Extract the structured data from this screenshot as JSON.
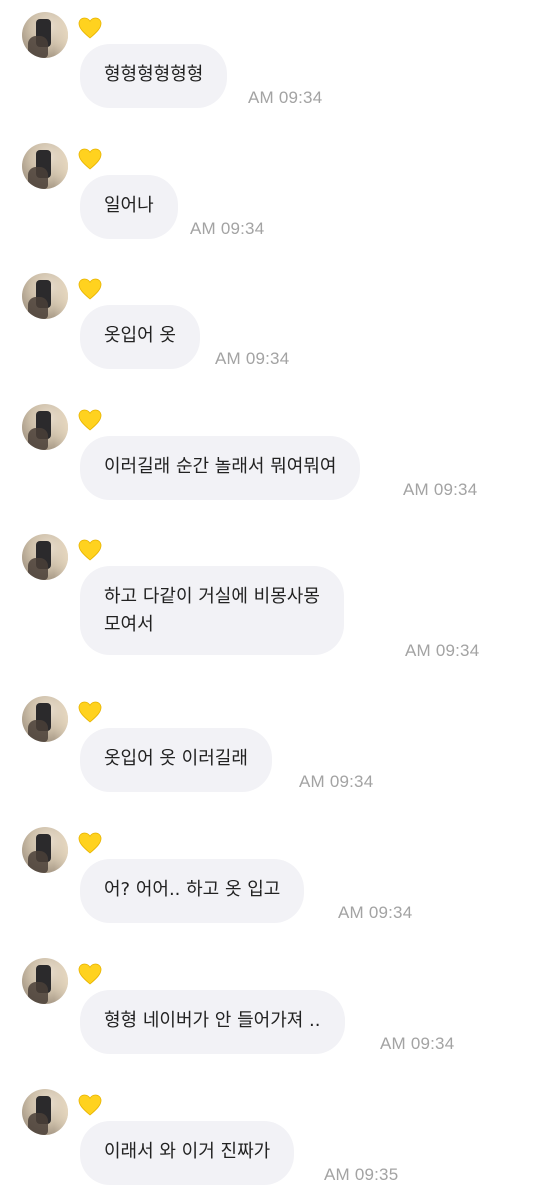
{
  "chat": {
    "messages": [
      {
        "sender_badge": "yellow-heart",
        "text": "형형형형형형",
        "time": "AM 09:34"
      },
      {
        "sender_badge": "yellow-heart",
        "text": "일어나",
        "time": "AM 09:34"
      },
      {
        "sender_badge": "yellow-heart",
        "text": "옷입어 옷",
        "time": "AM 09:34"
      },
      {
        "sender_badge": "yellow-heart",
        "text": "이러길래 순간 놀래서 뭐여뭐여",
        "time": "AM 09:34"
      },
      {
        "sender_badge": "yellow-heart",
        "text": "하고 다같이 거실에 비몽사몽\n모여서",
        "time": "AM 09:34"
      },
      {
        "sender_badge": "yellow-heart",
        "text": "옷입어 옷 이러길래",
        "time": "AM 09:34"
      },
      {
        "sender_badge": "yellow-heart",
        "text": "어? 어어.. 하고 옷 입고",
        "time": "AM 09:34"
      },
      {
        "sender_badge": "yellow-heart",
        "text": "형형 네이버가 안 들어가져 ..",
        "time": "AM 09:34"
      },
      {
        "sender_badge": "yellow-heart",
        "text": "이래서 와 이거 진짜가",
        "time": "AM 09:35"
      }
    ]
  },
  "colors": {
    "bubble_bg": "#f2f2f6",
    "text": "#222222",
    "timestamp": "#a3a3a3",
    "heart": "#ffd21f"
  }
}
